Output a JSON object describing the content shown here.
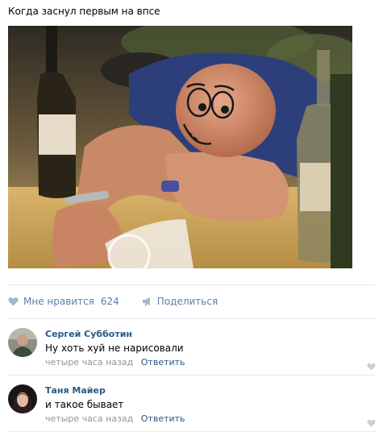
{
  "post": {
    "text": "Когда заснул первым на впсе"
  },
  "actions": {
    "like_label": "Мне нравится",
    "like_count": "624",
    "share_label": "Поделиться",
    "accent_color": "#5e80a6"
  },
  "comments": [
    {
      "author": "Сергей Субботин",
      "text": "Ну хоть хуй не нарисовали",
      "time": "четыре часа назад",
      "reply_label": "Ответить"
    },
    {
      "author": "Таня Майер",
      "text": "и такое бывает",
      "time": "четыре часа назад",
      "reply_label": "Ответить"
    }
  ],
  "icons": [
    "heart-icon",
    "megaphone-icon",
    "heart-icon"
  ]
}
